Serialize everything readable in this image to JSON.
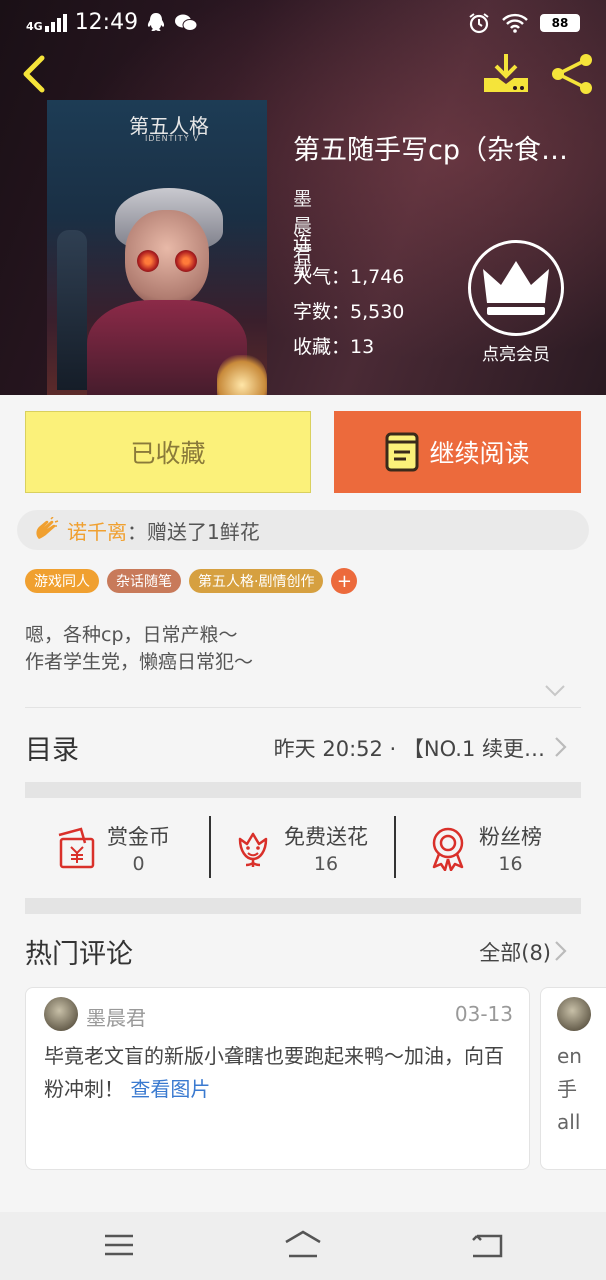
{
  "status_bar": {
    "network": "4G",
    "time": "12:49",
    "battery": "88"
  },
  "book": {
    "title": "第五随手写cp（杂食…",
    "author": "墨晨君",
    "status": "连载",
    "popularity": "人气：1,746",
    "word_count": "字数：5,530",
    "favorites": "收藏：13",
    "cover_title": "第五人格",
    "cover_subtitle": "IDENTITY V"
  },
  "vip": {
    "label": "点亮会员"
  },
  "buttons": {
    "favorited": "已收藏",
    "continue_reading": "继续阅读"
  },
  "gift": {
    "user": "诺千离",
    "text": "：赠送了1鲜花"
  },
  "tags": [
    {
      "label": "游戏同人",
      "color": "#f0a030"
    },
    {
      "label": "杂话随笔",
      "color": "#c87a5a"
    },
    {
      "label": "第五人格·剧情创作",
      "color": "#d6a040"
    }
  ],
  "tag_add": "+",
  "description": {
    "line1": "嗯，各种cp，日常产粮～",
    "line2": "作者学生党，懒癌日常犯～"
  },
  "toc": {
    "title": "目录",
    "update": "昨天 20:52 · 【NO.1 续更…"
  },
  "support": [
    {
      "label": "赏金币",
      "value": "0"
    },
    {
      "label": "免费送花",
      "value": "16"
    },
    {
      "label": "粉丝榜",
      "value": "16"
    }
  ],
  "comments": {
    "title": "热门评论",
    "all": "全部(8)",
    "items": [
      {
        "user": "墨晨君",
        "date": "03-13",
        "text": "毕竟老文盲的新版小聋瞎也要跑起来鸭～加油，向百粉冲刺！",
        "link": "查看图片"
      },
      {
        "line1": "en",
        "line2": "手",
        "line3": "all"
      }
    ]
  },
  "colors": {
    "accent_yellow": "#fbf17a",
    "accent_orange": "#ec6a3c",
    "icon_red": "#d9302a",
    "header_yellow": "#f5e43a"
  }
}
